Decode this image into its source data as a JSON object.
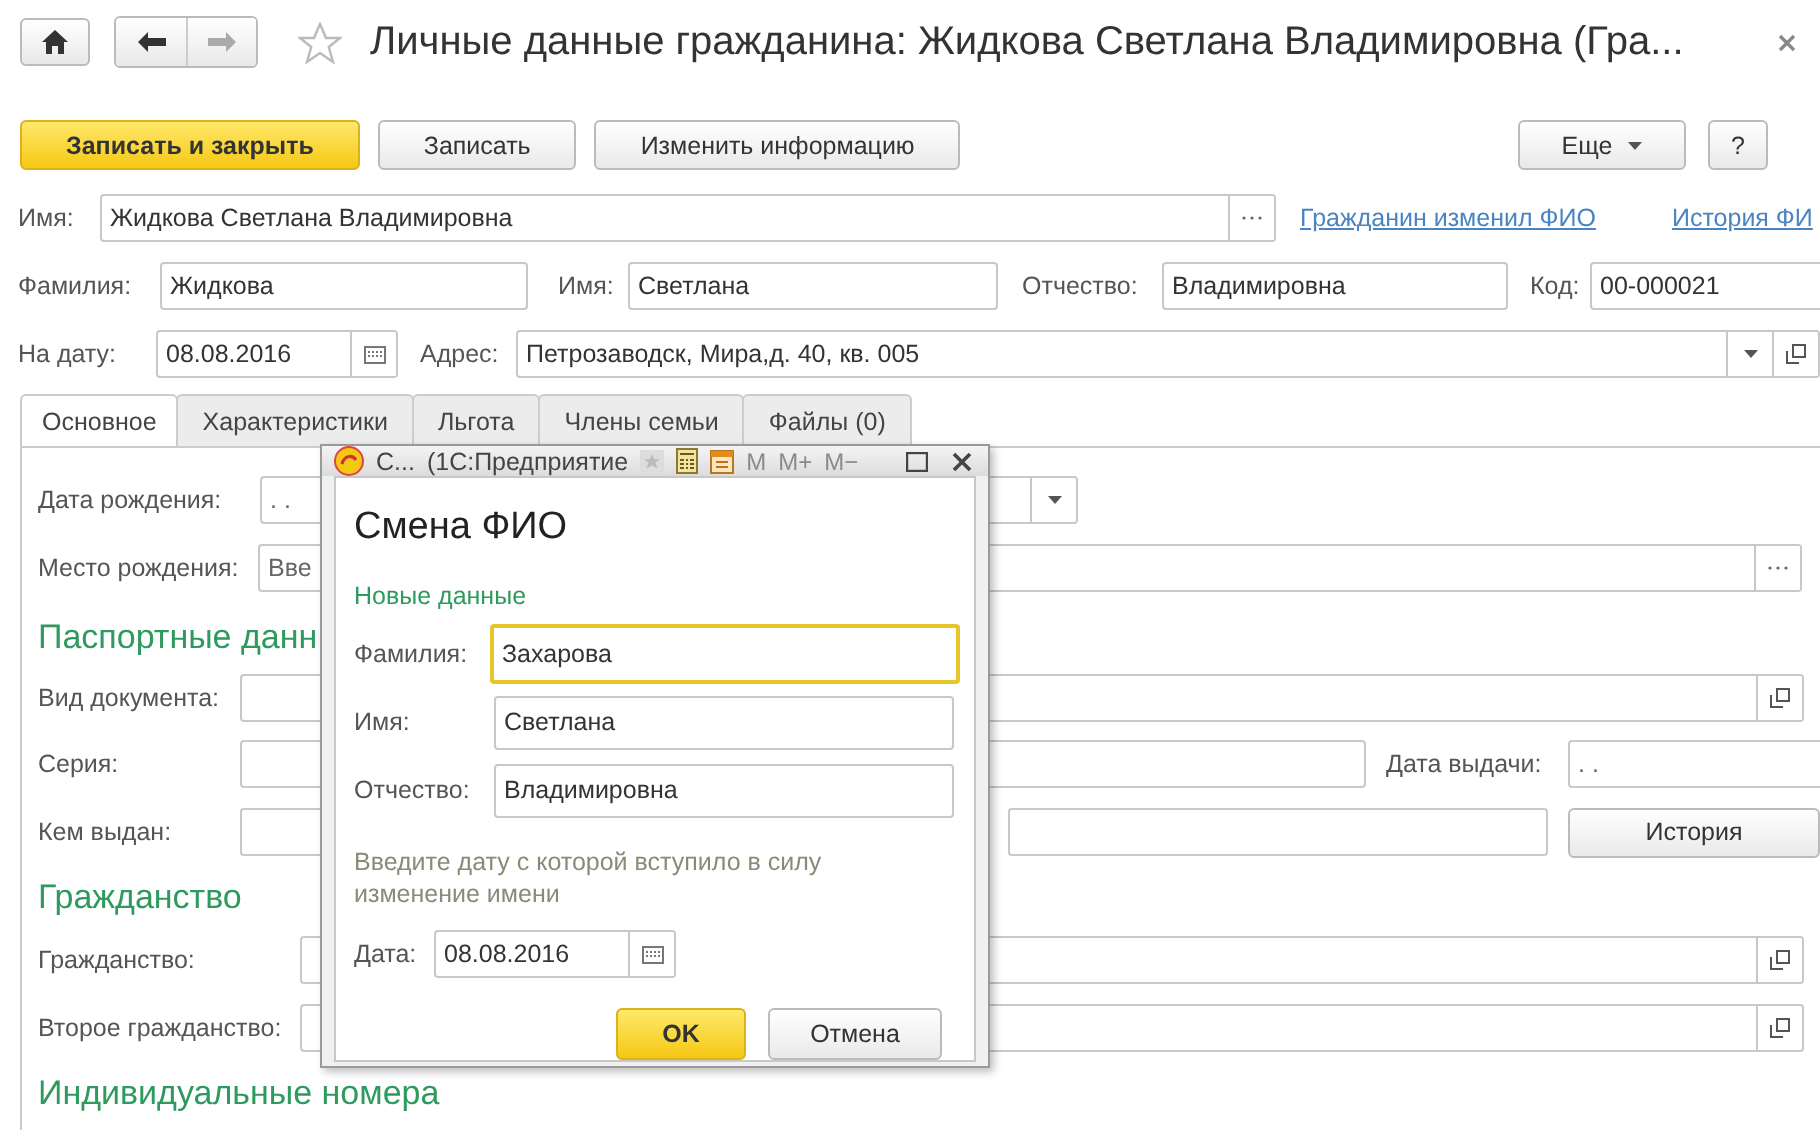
{
  "window": {
    "title": "Личные данные гражданина: Жидкова Светлана Владимировна (Гра..."
  },
  "toolbar": {
    "buttons": [
      {
        "label": "Записать и закрыть",
        "kind": "primary"
      },
      {
        "label": "Записать",
        "kind": "default"
      },
      {
        "label": "Изменить информацию",
        "kind": "default"
      }
    ],
    "more": "Еще",
    "help": "?"
  },
  "full_name": {
    "label": "Имя:",
    "value": "Жидкова Светлана Владимировна"
  },
  "links": [
    "Гражданин изменил ФИО",
    "История ФИ"
  ],
  "name_parts": [
    {
      "label": "Фамилия:",
      "value": "Жидкова"
    },
    {
      "label": "Имя:",
      "value": "Светлана"
    },
    {
      "label": "Отчество:",
      "value": "Владимировна"
    },
    {
      "label": "Код:",
      "value": "00-000021"
    }
  ],
  "on_date": {
    "label": "На дату:",
    "value": "08.08.2016"
  },
  "address": {
    "label": "Адрес:",
    "value": "Петрозаводск, Мира,д. 40, кв. 005"
  },
  "tabs": [
    {
      "label": "Основное",
      "selected": true
    },
    {
      "label": "Характеристики",
      "selected": false
    },
    {
      "label": "Льгота",
      "selected": false
    },
    {
      "label": "Члены семьи",
      "selected": false
    },
    {
      "label": "Файлы (0)",
      "selected": false
    }
  ],
  "main": {
    "birth_date": {
      "label": "Дата рождения:",
      "placeholder": " .  ."
    },
    "birth_place": {
      "label": "Место рождения:",
      "placeholder": "Вве"
    },
    "passport": {
      "heading": "Паспортные данн",
      "doc_type": {
        "label": "Вид документа:"
      },
      "series": {
        "label": "Серия:"
      },
      "issue_date": {
        "label": "Дата выдачи:",
        "placeholder": " .  ."
      },
      "issued_by": {
        "label": "Кем выдан:"
      },
      "history": "История"
    },
    "citizenship": {
      "heading": "Гражданство",
      "first": {
        "label": "Гражданство:"
      },
      "second": {
        "label": "Второе гражданство:"
      }
    },
    "ids_heading": "Индивидуальные номера"
  },
  "dialog": {
    "title": "С...",
    "app": "(1С:Предприятие",
    "memory": [
      {
        "label": "M",
        "disabled": true
      },
      {
        "label": "M+",
        "disabled": true
      },
      {
        "label": "M−",
        "disabled": true
      }
    ],
    "heading": "Смена ФИО",
    "section": "Новые данные",
    "fields": [
      {
        "label": "Фамилия:",
        "value": "Захарова",
        "focused": true
      },
      {
        "label": "Имя:",
        "value": "Светлана",
        "focused": false
      },
      {
        "label": "Отчество:",
        "value": "Владимировна",
        "focused": false
      }
    ],
    "hint": "Введите дату с которой вступило в силу изменение имени",
    "date": {
      "label": "Дата:",
      "value": "08.08.2016"
    },
    "buttons": [
      {
        "label": "OK",
        "kind": "primary"
      },
      {
        "label": "Отмена",
        "kind": "default"
      }
    ]
  }
}
